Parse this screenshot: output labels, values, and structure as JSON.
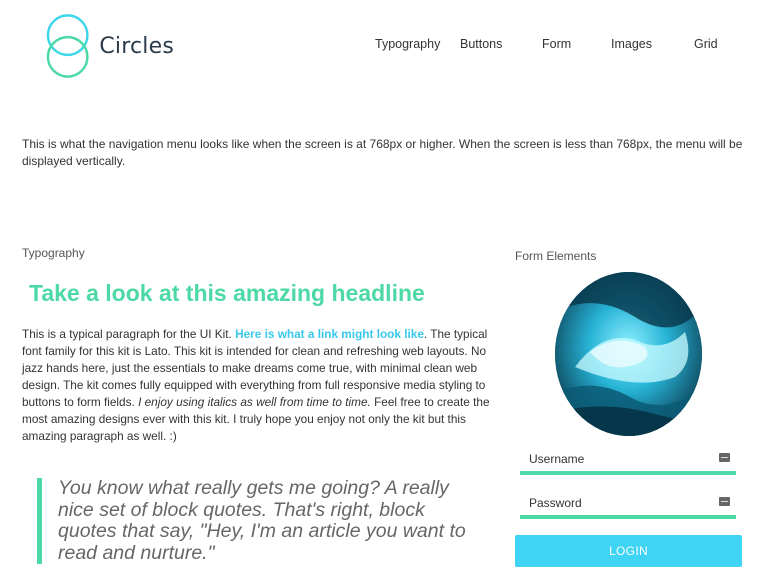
{
  "brand": {
    "name": "Circles",
    "accent": "#4cd9a6",
    "link_color": "#38c8ea"
  },
  "nav": {
    "items": [
      "Typography",
      "Buttons",
      "Form",
      "Images",
      "Grid"
    ]
  },
  "nav_note": "This is what the navigation menu looks like when the screen is at 768px or higher. When the screen is less than 768px, the menu will be displayed vertically.",
  "typography": {
    "label": "Typography",
    "headline": "Take a look at this amazing headline",
    "para_1": "This is a typical paragraph for the UI Kit. ",
    "link": "Here is what a link might look like",
    "para_2": ". The typical font family for this kit is Lato. This kit is intended for clean and refreshing web layouts. No jazz hands here, just the essentials to make dreams come true, with minimal clean web design. The kit comes fully equipped with everything from full responsive media styling to buttons to form fields. ",
    "italic": "I enjoy using italics as well from time to time.",
    "para_3": " Feel free to create the most amazing designs ever with this kit. I truly hope you enjoy not only the kit but this amazing paragraph as well. :)",
    "blockquote": "You know what really gets me going? A really nice set of block quotes. That's right, block quotes that say, \"Hey, I'm an article you want to read and nurture.\""
  },
  "form": {
    "label": "Form Elements",
    "username_placeholder": "Username",
    "password_placeholder": "Password",
    "login_label": "LOGIN",
    "button_color": "#3fd3f4"
  }
}
